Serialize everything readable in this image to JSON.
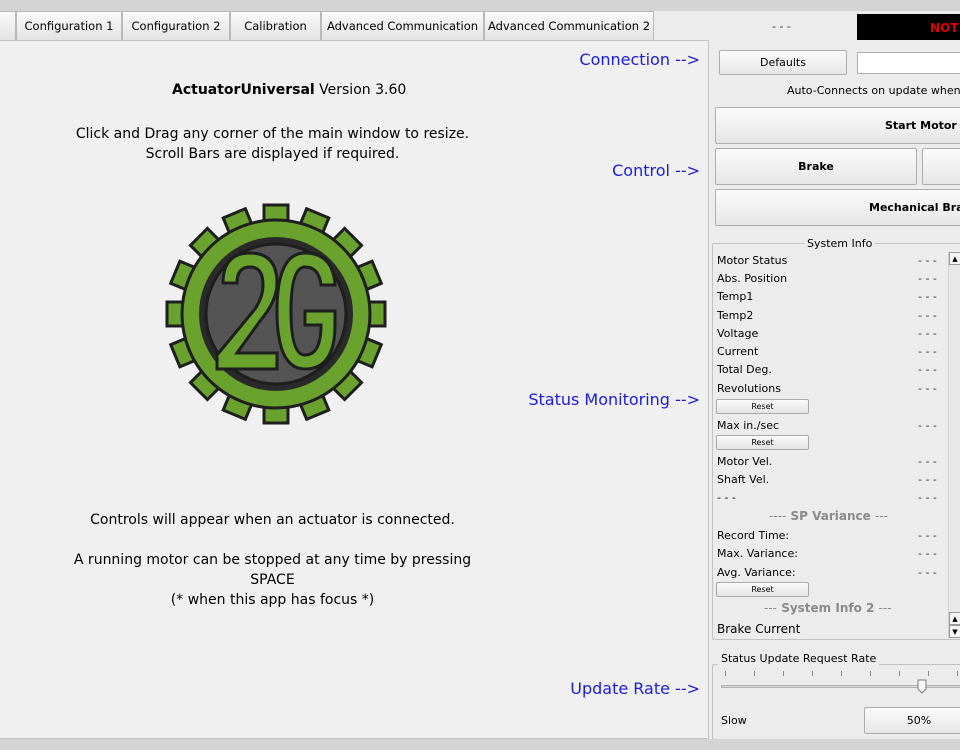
{
  "tabs": [
    {
      "label": ""
    },
    {
      "label": "Configuration 1"
    },
    {
      "label": "Configuration 2"
    },
    {
      "label": "Calibration"
    },
    {
      "label": "Advanced Communication"
    },
    {
      "label": "Advanced Communication 2"
    }
  ],
  "header": {
    "status": "- - -",
    "connection_badge": "NOT",
    "badge_color": "#e00000"
  },
  "main": {
    "app_name": "ActuatorUniversal",
    "version": "Version 3.60",
    "resize_line1": "Click and Drag any corner of the main window to resize.",
    "resize_line2": "Scroll Bars are displayed if required.",
    "logo_text": "2G",
    "controls_note": "Controls will appear when an actuator is connected.",
    "stop_line1": "A running motor can be stopped at any time by pressing",
    "stop_line2": "SPACE",
    "stop_line3": "(* when this app has focus *)",
    "labels": {
      "connection": "Connection -->",
      "control": "Control -->",
      "status_monitoring": "Status Monitoring -->",
      "update_rate": "Update Rate -->"
    },
    "label_color": "#1c1cd6"
  },
  "right": {
    "defaults_label": "Defaults",
    "auto_connect": "Auto-Connects on update when a",
    "start_motor": "Start Motor",
    "brake": "Brake",
    "mechanical_brake": "Mechanical Brak",
    "system_info": {
      "title": "System Info",
      "rows": [
        {
          "label": "Motor Status",
          "value": "- - -"
        },
        {
          "label": "Abs. Position",
          "value": "- - -"
        },
        {
          "label": "Temp1",
          "value": "- - -"
        },
        {
          "label": "Temp2",
          "value": "- - -"
        },
        {
          "label": "Voltage",
          "value": "- - -"
        },
        {
          "label": "Current",
          "value": "- - -"
        },
        {
          "label": "Total Deg.",
          "value": "- - -"
        },
        {
          "label": "Revolutions",
          "value": "- - -"
        },
        {
          "label": "Max in./sec",
          "value": "- - -"
        },
        {
          "label": "Motor Vel.",
          "value": "- - -"
        },
        {
          "label": "Shaft Vel.",
          "value": "- - -"
        },
        {
          "label": "- - -",
          "value": "- - -"
        },
        {
          "label": "Record Time:",
          "value": "- - -"
        },
        {
          "label": "Max. Variance:",
          "value": "- - -"
        },
        {
          "label": "Avg. Variance:",
          "value": "- - -"
        }
      ],
      "reset_label": "Reset",
      "sp_variance": {
        "dash_left": "----",
        "name": "SP Variance",
        "dash_right": "---"
      },
      "system_info2": {
        "dash_left": "---",
        "name": "System Info 2",
        "dash_right": "---"
      },
      "brake_current": "Brake Current"
    },
    "update_rate": {
      "title": "Status Update Request Rate",
      "slow": "Slow",
      "value": "50%",
      "level_fraction": 0.87
    }
  }
}
